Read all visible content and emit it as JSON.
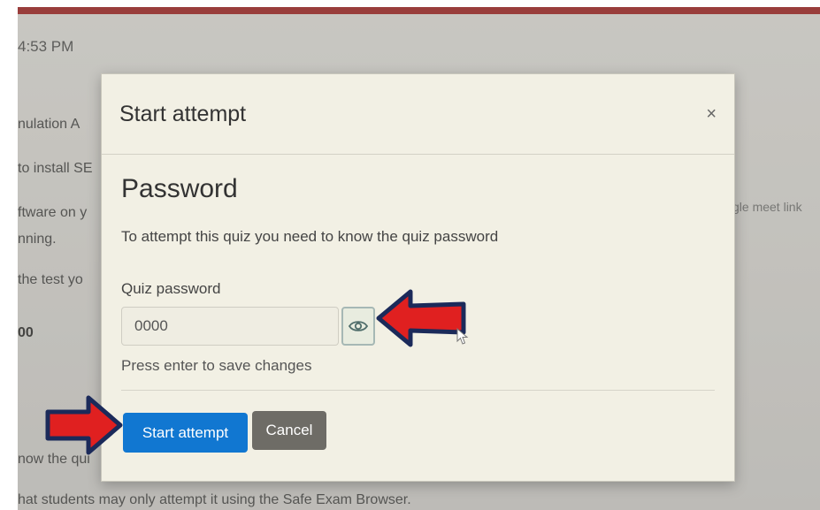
{
  "background": {
    "time_fragment": "4:53 PM",
    "lines": [
      "nulation A",
      "to install SE",
      "ftware on y",
      "nning.",
      "the test yo",
      "00",
      "now the qui",
      "hat students may only attempt it using the Safe Exam Browser."
    ],
    "right_fragment": "gle meet link"
  },
  "modal": {
    "title": "Start attempt",
    "close_symbol": "×",
    "heading": "Password",
    "description": "To attempt this quiz you need to know the quiz password",
    "field_label": "Quiz password",
    "field_value": "0000",
    "help_text": "Press enter to save changes",
    "start_button": "Start attempt",
    "cancel_button": "Cancel",
    "reveal_icon": "eye-icon"
  },
  "colors": {
    "primary": "#1177d1",
    "secondary": "#6e6c66",
    "top_bar": "#a52a2a",
    "annotation_arrow": "#e02020",
    "annotation_outline": "#1b2a5a"
  }
}
